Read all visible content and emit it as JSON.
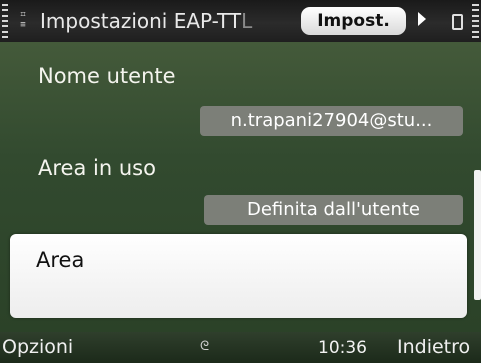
{
  "header": {
    "title_main": "Impostazioni EAP-TT",
    "title_faded": "L",
    "tab_label": "Impost.",
    "icons": {
      "app": "app-icon",
      "next_tab": "chevron-right-icon",
      "battery": "battery-icon"
    }
  },
  "form": {
    "username": {
      "label": "Nome utente",
      "value": "n.trapani27904@stu..."
    },
    "realm_in_use": {
      "label": "Area in uso",
      "value": "Definita dall'utente"
    },
    "realm": {
      "label": "Area"
    }
  },
  "softkeys": {
    "left": "Opzioni",
    "clock": "10:36",
    "right": "Indietro",
    "center_icon": "connection-icon"
  },
  "colors": {
    "background": "#2b4228",
    "value_box": "#7c7f78",
    "selection": "#ffffff"
  }
}
